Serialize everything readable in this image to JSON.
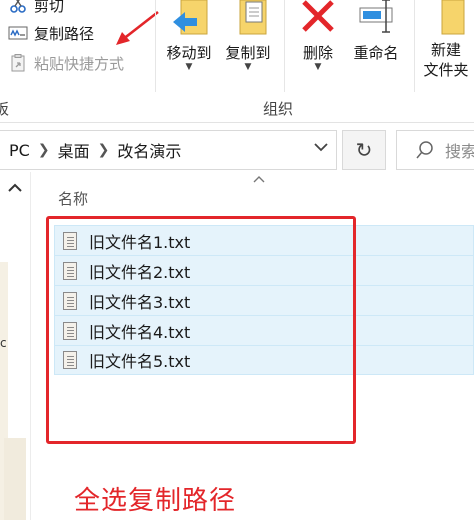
{
  "ribbon": {
    "clipboard": {
      "cut_label": "剪切",
      "copy_path_label": "复制路径",
      "paste_shortcut_label": "粘贴快捷方式"
    },
    "left_group_label_fragment": "板",
    "organize": {
      "move_to_label": "移动到",
      "copy_to_label": "复制到",
      "delete_label": "删除",
      "rename_label": "重命名",
      "group_label": "组织"
    },
    "new": {
      "new_folder_label": "新建\n文件夹"
    }
  },
  "address_bar": {
    "crumbs": [
      "PC",
      "桌面",
      "改名演示"
    ],
    "search_placeholder": "搜索"
  },
  "file_list": {
    "column_name": "名称",
    "files": [
      "旧文件名1.txt",
      "旧文件名2.txt",
      "旧文件名3.txt",
      "旧文件名4.txt",
      "旧文件名5.txt"
    ]
  },
  "annotation": {
    "caption": "全选复制路径",
    "color": "#e3262a"
  },
  "nav": {
    "stub_text": "c"
  }
}
